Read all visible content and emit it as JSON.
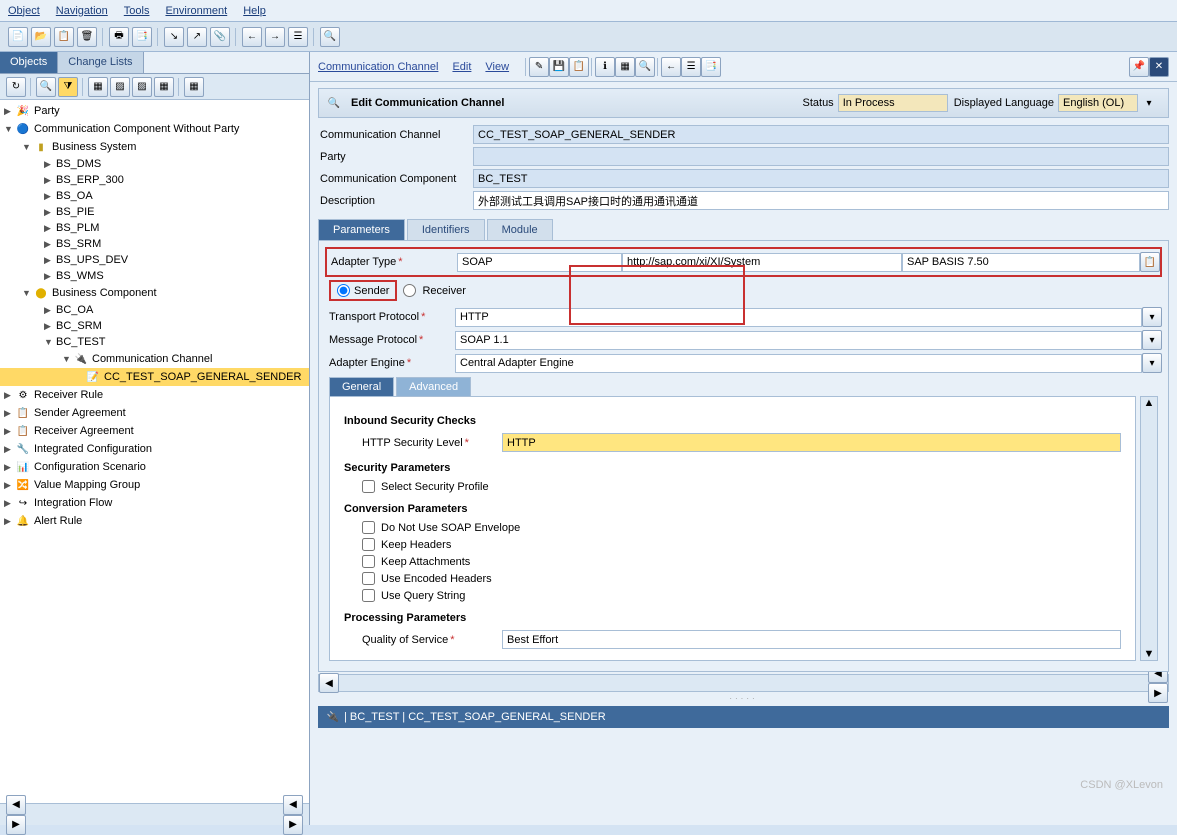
{
  "menu": {
    "object": "Object",
    "navigation": "Navigation",
    "tools": "Tools",
    "environment": "Environment",
    "help": "Help"
  },
  "side": {
    "tabs": {
      "objects": "Objects",
      "changelists": "Change Lists"
    },
    "tree": {
      "party": "Party",
      "ccwp": "Communication Component Without Party",
      "bs": "Business System",
      "bs_items": [
        "BS_DMS",
        "BS_ERP_300",
        "BS_OA",
        "BS_PIE",
        "BS_PLM",
        "BS_SRM",
        "BS_UPS_DEV",
        "BS_WMS"
      ],
      "bc": "Business Component",
      "bc_oa": "BC_OA",
      "bc_srm": "BC_SRM",
      "bc_test": "BC_TEST",
      "commch": "Communication Channel",
      "cc_item": "CC_TEST_SOAP_GENERAL_SENDER",
      "rr": "Receiver Rule",
      "sa": "Sender Agreement",
      "ra": "Receiver Agreement",
      "ic": "Integrated Configuration",
      "cs": "Configuration Scenario",
      "vmg": "Value Mapping Group",
      "if": "Integration Flow",
      "ar": "Alert Rule"
    }
  },
  "ctop": {
    "cc": "Communication Channel",
    "edit": "Edit",
    "view": "View"
  },
  "hdr": {
    "title": "Edit Communication Channel",
    "status_l": "Status",
    "status_v": "In Process",
    "lang_l": "Displayed Language",
    "lang_v": "English (OL)"
  },
  "form": {
    "cc_l": "Communication Channel",
    "cc_v": "CC_TEST_SOAP_GENERAL_SENDER",
    "party_l": "Party",
    "party_v": "",
    "ccomp_l": "Communication Component",
    "ccomp_v": "BC_TEST",
    "desc_l": "Description",
    "desc_v": "外部测试工具调用SAP接口时的通用通讯通道"
  },
  "maintabs": {
    "params": "Parameters",
    "ident": "Identifiers",
    "module": "Module"
  },
  "params": {
    "at_l": "Adapter Type",
    "at_v": "SOAP",
    "at_ns": "http://sap.com/xi/XI/System",
    "at_swc": "SAP BASIS 7.50",
    "sender": "Sender",
    "receiver": "Receiver",
    "tp_l": "Transport Protocol",
    "tp_v": "HTTP",
    "mp_l": "Message Protocol",
    "mp_v": "SOAP 1.1",
    "ae_l": "Adapter Engine",
    "ae_v": "Central Adapter Engine"
  },
  "subtabs": {
    "general": "General",
    "advanced": "Advanced"
  },
  "detail": {
    "isc": "Inbound Security Checks",
    "hsl_l": "HTTP Security Level",
    "hsl_v": "HTTP",
    "sp": "Security Parameters",
    "ssp": "Select Security Profile",
    "cp": "Conversion Parameters",
    "c1": "Do Not Use SOAP Envelope",
    "c2": "Keep Headers",
    "c3": "Keep Attachments",
    "c4": "Use Encoded Headers",
    "c5": "Use Query String",
    "pp": "Processing Parameters",
    "qos_l": "Quality of Service",
    "qos_v": "Best Effort"
  },
  "status": "| BC_TEST | CC_TEST_SOAP_GENERAL_SENDER",
  "watermark": "CSDN @XLevon"
}
